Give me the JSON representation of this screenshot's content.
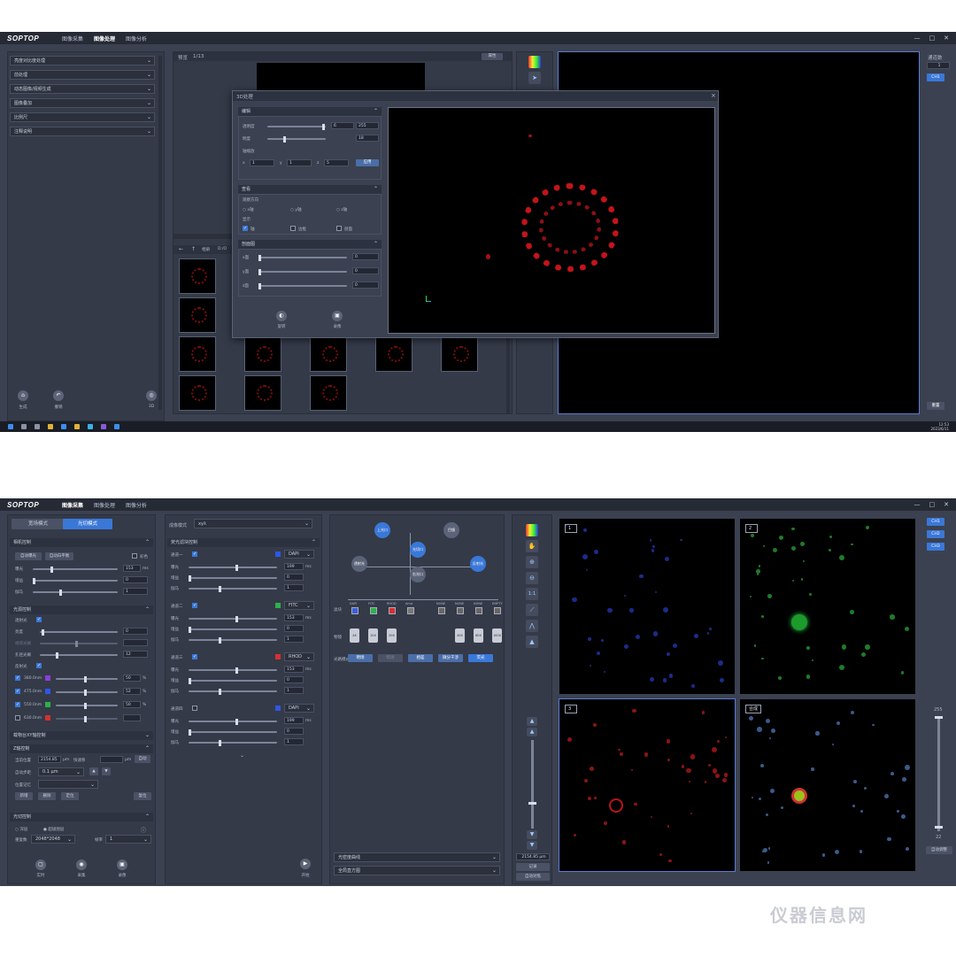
{
  "top": {
    "app": {
      "logo": "SOPTOP",
      "tabs": [
        "图像采集",
        "图像处理",
        "图像分析"
      ],
      "window_buttons": [
        "—",
        "□",
        "✕"
      ]
    },
    "left_menu": [
      {
        "label": "亮度对比度处理"
      },
      {
        "label": "前处理"
      },
      {
        "label": "动态图像/视频生成"
      },
      {
        "label": "图像叠加"
      },
      {
        "label": "比例尺"
      },
      {
        "label": "注释说明"
      }
    ],
    "left_actions": {
      "generate": "生成",
      "undo": "撤销",
      "three_d": "3D"
    },
    "preview": {
      "label": "预览",
      "page": "1/13",
      "action": "属性"
    },
    "browser": {
      "path_prefix": "相册",
      "path": "D:/O"
    },
    "dialog": {
      "title": "3D处理",
      "edit": {
        "header": "编辑",
        "transparency_label": "透明度",
        "transparency_value": "6",
        "transparency_max": "255",
        "brightness_label": "明度",
        "brightness_value": "18",
        "axis_label": "轴缩放",
        "x_label": "x",
        "x_value": "1",
        "y_label": "y",
        "y_value": "1",
        "z_label": "z",
        "z_value": "5",
        "apply": "应用"
      },
      "view": {
        "header": "查看",
        "direction_label": "观察方向",
        "x_axis": "x轴",
        "y_axis": "y轴",
        "z_axis": "z轴",
        "display_label": "显示",
        "axis": "轴",
        "border": "边框",
        "section": "剖面"
      },
      "section": {
        "header": "剖面图",
        "rows": [
          {
            "label": "x面",
            "value": "0"
          },
          {
            "label": "y面",
            "value": "0"
          },
          {
            "label": "z面",
            "value": "0"
          }
        ]
      },
      "buttons": {
        "rotate": "旋转",
        "record": "录像"
      }
    },
    "right": {
      "channels_label": "通道数",
      "channel_count": "1",
      "ch_button": "CH1",
      "reset": "重置"
    },
    "clock": {
      "time": "12:53",
      "date": "2023/6/11"
    }
  },
  "bottom": {
    "app": {
      "logo": "SOPTOP",
      "tabs": [
        "图像采集",
        "图像处理",
        "图像分析"
      ],
      "window_buttons": [
        "—",
        "□",
        "✕"
      ]
    },
    "modes": {
      "wide": "宽场模式",
      "light": "光切模式"
    },
    "camera": {
      "header": "相机控制",
      "auto_exposure": "自动曝光",
      "auto_wb": "自动白平衡",
      "color": "彩色",
      "exposure_label": "曝光",
      "exposure_value": "153",
      "exposure_unit": "ms",
      "gain_label": "增益",
      "gain_value": "0",
      "gamma_label": "伽马",
      "gamma_value": "1"
    },
    "light": {
      "header": "光源控制",
      "transmitted": "透射光",
      "brightness_label": "亮度",
      "brightness_value": "0",
      "diaphragm_label": "视场光阑",
      "aperture_label": "孔径光阑",
      "aperture_value": "12",
      "reflected": "反射光",
      "wavelengths": [
        {
          "label": "380.0nm",
          "value": "50",
          "unit": "%",
          "color": "#8a3fd8",
          "on": true
        },
        {
          "label": "475.0nm",
          "value": "52",
          "unit": "%",
          "color": "#2f56e8",
          "on": true
        },
        {
          "label": "550.0nm",
          "value": "50",
          "unit": "%",
          "color": "#2bb24a",
          "on": true
        },
        {
          "label": "630.0nm",
          "value": "",
          "unit": "",
          "color": "#d82f2f",
          "on": false
        }
      ]
    },
    "stage": {
      "header": "载物台XY轴控制"
    },
    "z": {
      "header": "Z轴控制",
      "pos_label": "当前位置",
      "pos_value": "2154.85",
      "pos_unit": "μm",
      "fast_label": "快速移",
      "fast_unit": "μm",
      "auto": "自动",
      "step_label": "自动步距",
      "step_value": "0.1 μm",
      "memory_label": "位置记忆",
      "add": "新增",
      "delete": "删除",
      "locate": "定位",
      "reset": "复位"
    },
    "light_ctrl": {
      "header": "光切控制",
      "opt1": "深层",
      "opt2": "超级图层",
      "resolution_label": "重复数",
      "resolution_value": "2048*2048",
      "frame_label": "帧率",
      "frame_value": "1"
    },
    "bottom_actions": {
      "realtime": "实时",
      "capture": "采集",
      "record": "录像",
      "start": "开始"
    },
    "imaging": {
      "mode_label": "成像模式",
      "mode_value": "xyλ"
    },
    "fluor": {
      "header": "荧光滤块控制",
      "channels": [
        {
          "name": "通道一",
          "on": true,
          "color": "#2f56e8",
          "filter": "DAPI",
          "exp": "199",
          "gain": "0",
          "gamma": "1"
        },
        {
          "name": "通道二",
          "on": true,
          "color": "#2bb24a",
          "filter": "FITC",
          "exp": "153",
          "gain": "0",
          "gamma": "1"
        },
        {
          "name": "通道三",
          "on": true,
          "color": "#d82f2f",
          "filter": "RHOD",
          "exp": "153",
          "gain": "0",
          "gamma": "1"
        },
        {
          "name": "通道四",
          "on": false,
          "color": "#2f56e8",
          "filter": "DAPI",
          "exp": "199",
          "gain": "0",
          "gamma": "1"
        }
      ],
      "exp_label": "曝光",
      "gain_label": "增益",
      "gamma_label": "伽马",
      "unit": "ms"
    },
    "lightpath": {
      "nodes": [
        "上光口",
        "目镜",
        "光切口",
        "反射光",
        "透射光",
        "右光口"
      ],
      "filters": [
        "DAPI",
        "FITC",
        "RHOD",
        "Amd",
        "NONE",
        "NONE",
        "NONE",
        "EMPTY"
      ],
      "filter_label": "滤块",
      "objective_label": "物镜",
      "objectives": [
        "4X",
        "10X",
        "20X",
        "40X",
        "60X",
        "100X"
      ],
      "mode_label": "光路模式",
      "modes": [
        "明场",
        "暗场",
        "相差",
        "微分干涉",
        "荧光"
      ],
      "dropdowns": [
        "光密度曲线",
        "全局直方图"
      ]
    },
    "toolbar": {
      "one_to_one": "1:1",
      "z_value": "2154.85 μm",
      "record": "记录",
      "auto_focus": "自动对焦"
    },
    "viewer": {
      "tags": [
        "1",
        "2",
        "3",
        "合成"
      ],
      "channels": [
        "CH1",
        "CH2",
        "CH3"
      ],
      "max": "255",
      "min": "22",
      "auto_contrast": "自动调整"
    }
  },
  "watermark": "仪器信息网"
}
